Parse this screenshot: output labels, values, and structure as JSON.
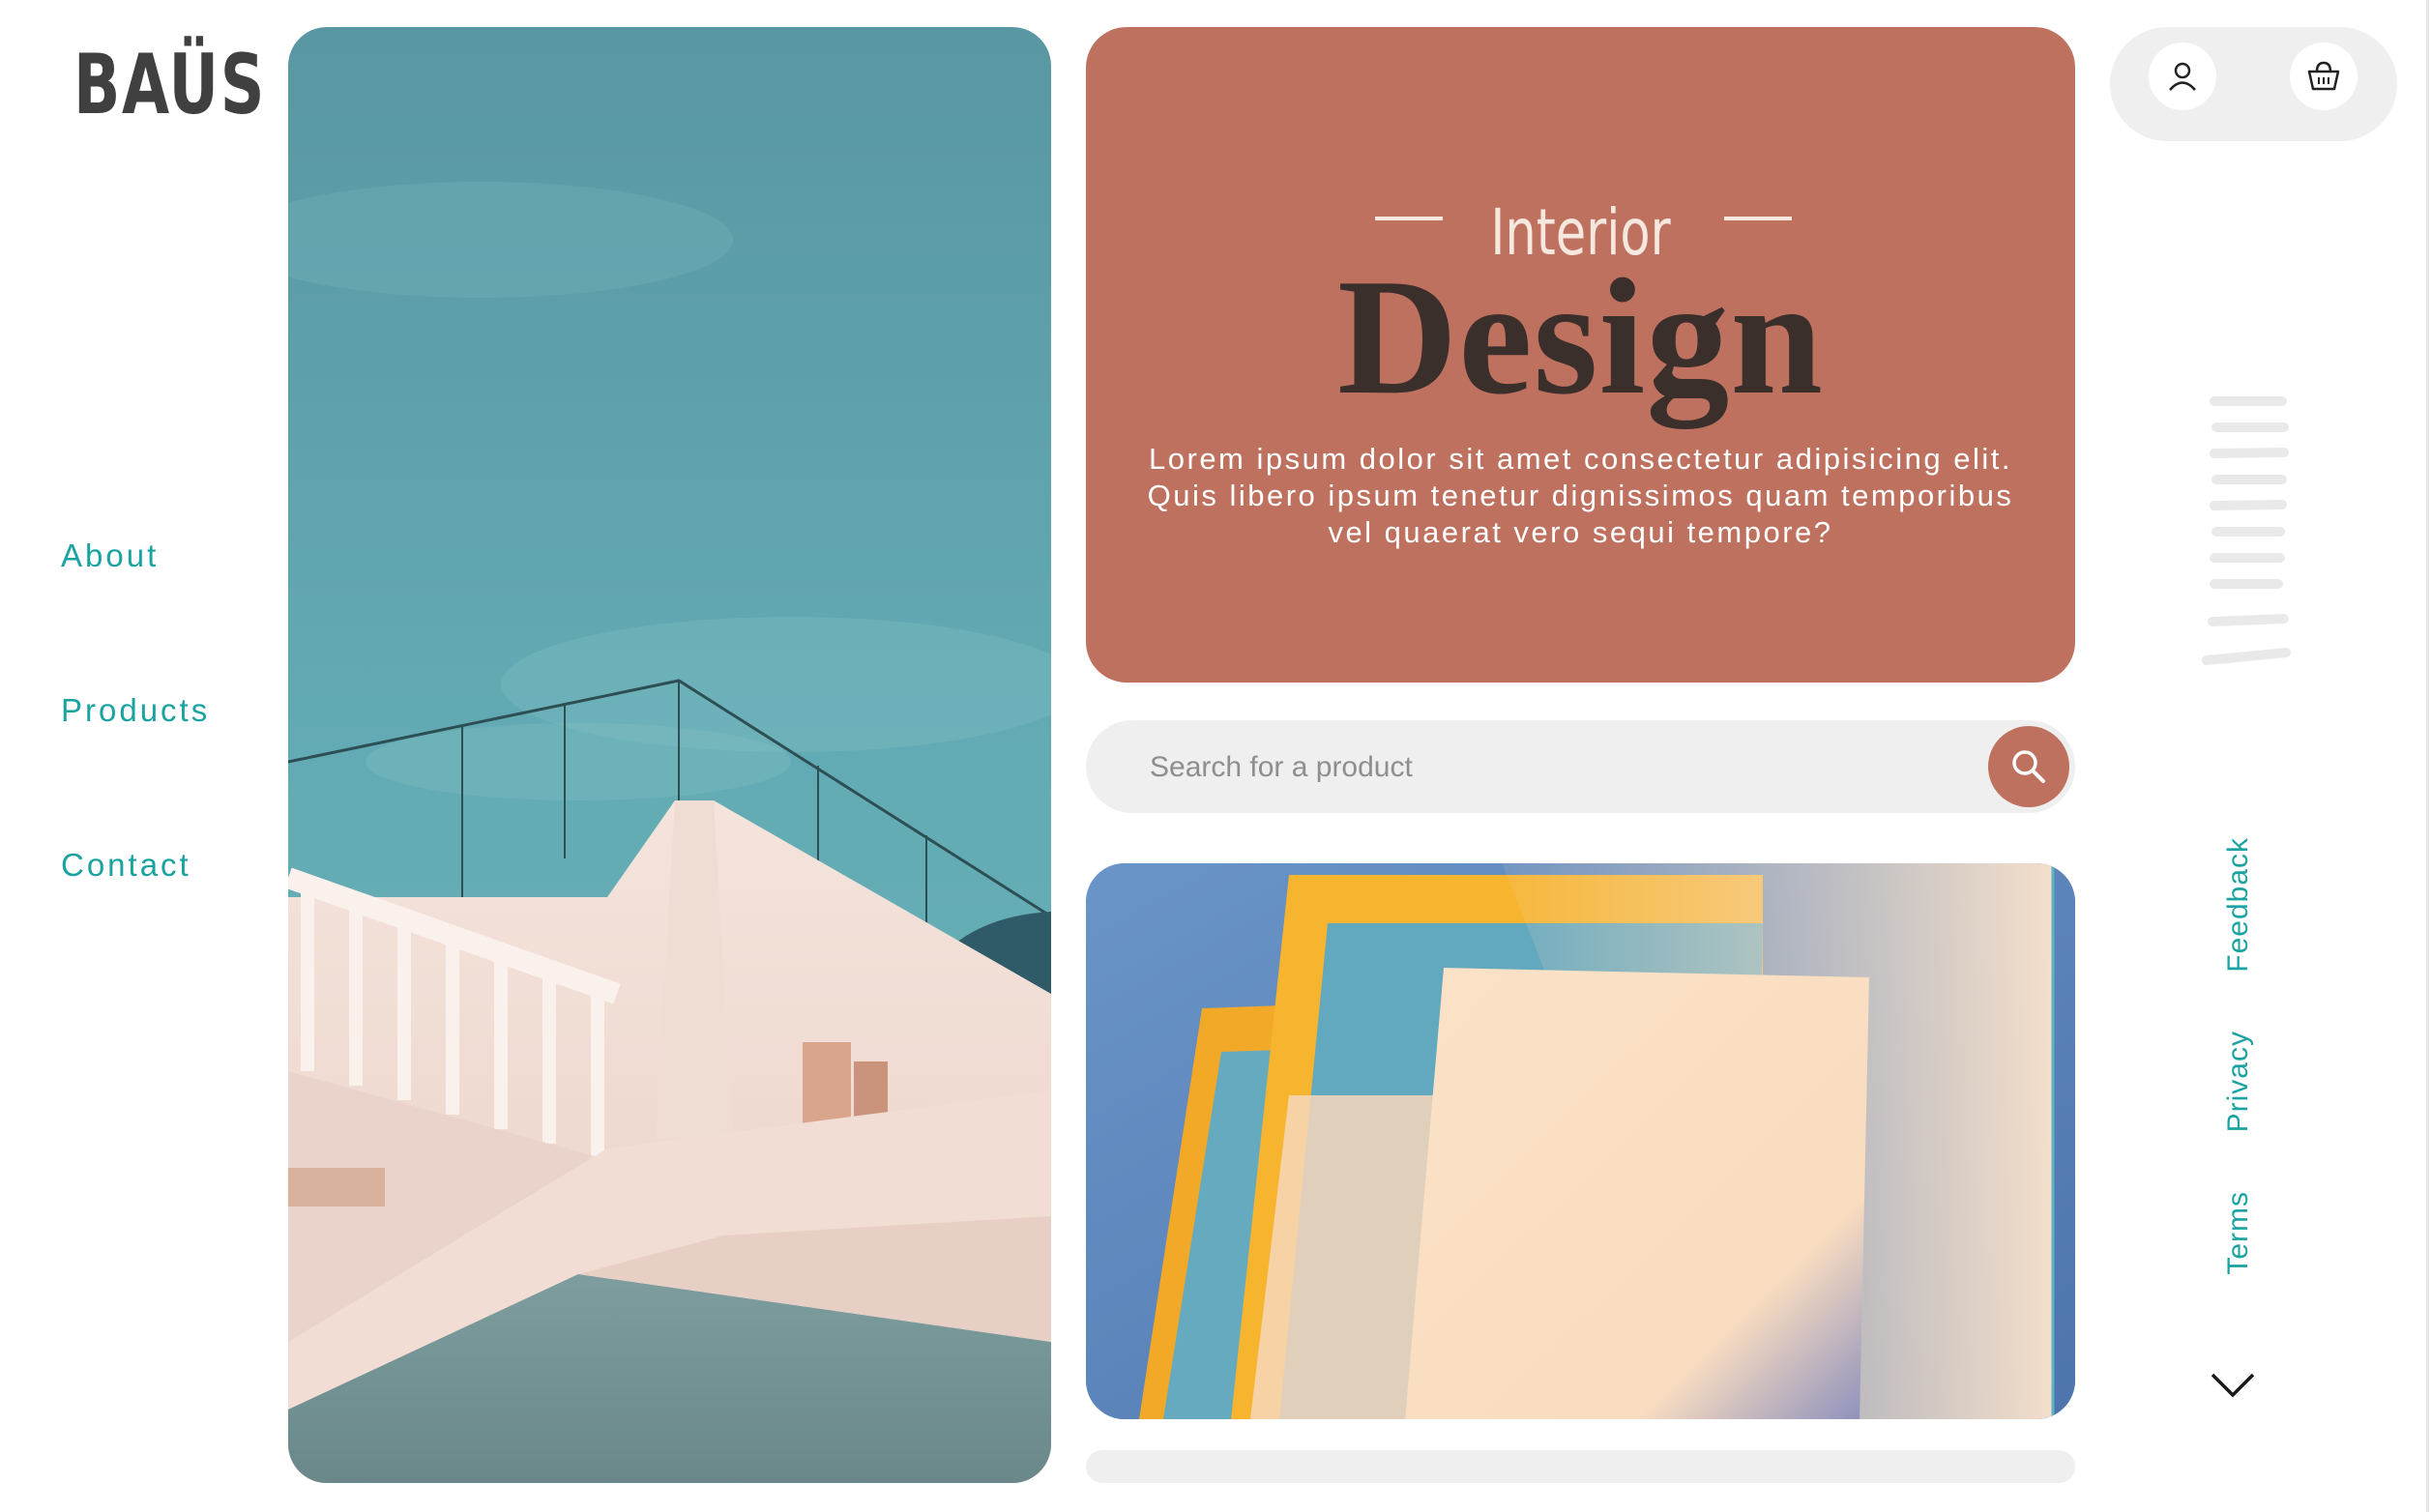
{
  "brand": {
    "logo": "BAÜS"
  },
  "nav": {
    "items": [
      {
        "label": "About"
      },
      {
        "label": "Products"
      },
      {
        "label": "Contact"
      }
    ]
  },
  "hero": {
    "eyebrow": "Interior",
    "title": "Design",
    "text": "Lorem ipsum dolor sit amet consectetur adipisicing elit. Quis libero ipsum tenetur dignissimos quam temporibus vel quaerat vero sequi tempore?"
  },
  "search": {
    "placeholder": "Search for a product",
    "value": ""
  },
  "header_icons": {
    "user": "user-icon",
    "cart": "basket-icon"
  },
  "footer_links": [
    {
      "label": "Feedback"
    },
    {
      "label": "Privacy"
    },
    {
      "label": "Terms"
    }
  ],
  "icons": {
    "search": "search-icon",
    "menu": "hamburger-lines-icon",
    "scroll": "chevron-down-icon"
  },
  "colors": {
    "accent": "#1aa3a0",
    "terracotta": "#bf715f",
    "dark_text": "#3a2f2b",
    "sky": "#5fa7b0"
  }
}
